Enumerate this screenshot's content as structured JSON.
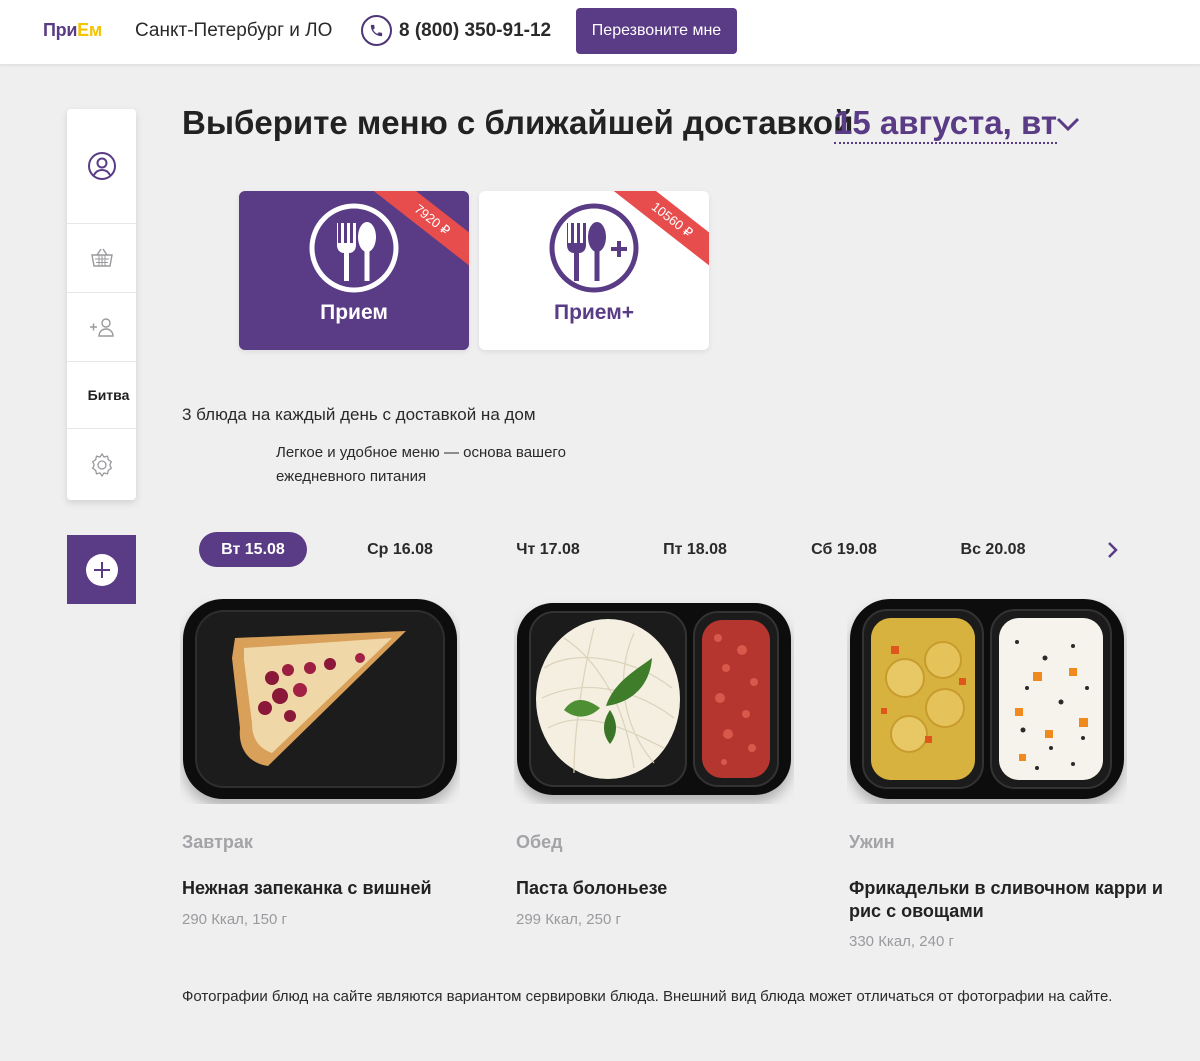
{
  "header": {
    "logo_main": "При",
    "logo_accent": "Ем",
    "city": "Санкт-Петербург и ЛО",
    "phone": "8 (800) 350-91-12",
    "callback_label": "Перезвоните мне"
  },
  "sidebar": {
    "items": [
      {
        "icon": "user-icon"
      },
      {
        "icon": "basket-icon"
      },
      {
        "icon": "add-user-icon"
      },
      {
        "label": "Битва"
      },
      {
        "icon": "gear-icon"
      }
    ],
    "add_icon": "plus-icon"
  },
  "title": {
    "text": "Выберите меню с ближайшей доставкой",
    "date": "15 августа, вт"
  },
  "menus": [
    {
      "name": "Прием",
      "price": "7920 ₽",
      "active": true
    },
    {
      "name": "Прием+",
      "price": "10560 ₽",
      "active": false
    }
  ],
  "description": {
    "line1": "3 блюда на каждый день с доставкой на дом",
    "line2": "Легкое и удобное меню — основа вашего ежедневного питания"
  },
  "days": [
    "Вт 15.08",
    "Ср 16.08",
    "Чт 17.08",
    "Пт 18.08",
    "Сб 19.08",
    "Вс 20.08"
  ],
  "active_day": "Вт 15.08",
  "dishes": [
    {
      "meal": "Завтрак",
      "name": "Нежная запеканка с вишней",
      "info": "290 Ккал, 150 г"
    },
    {
      "meal": "Обед",
      "name": "Паста болоньезе",
      "info": "299 Ккал, 250 г"
    },
    {
      "meal": "Ужин",
      "name": "Фрикадельки в сливочном карри и рис с овощами",
      "info": "330 Ккал, 240 г"
    }
  ],
  "note": "Фотографии блюд на сайте являются вариантом сервировки блюда. Внешний вид блюда может отличаться от фотографии на сайте.",
  "colors": {
    "brand": "#5a3b85",
    "accent": "#f3c400",
    "ribbon": "#e84d4d",
    "background": "#efeff0"
  }
}
